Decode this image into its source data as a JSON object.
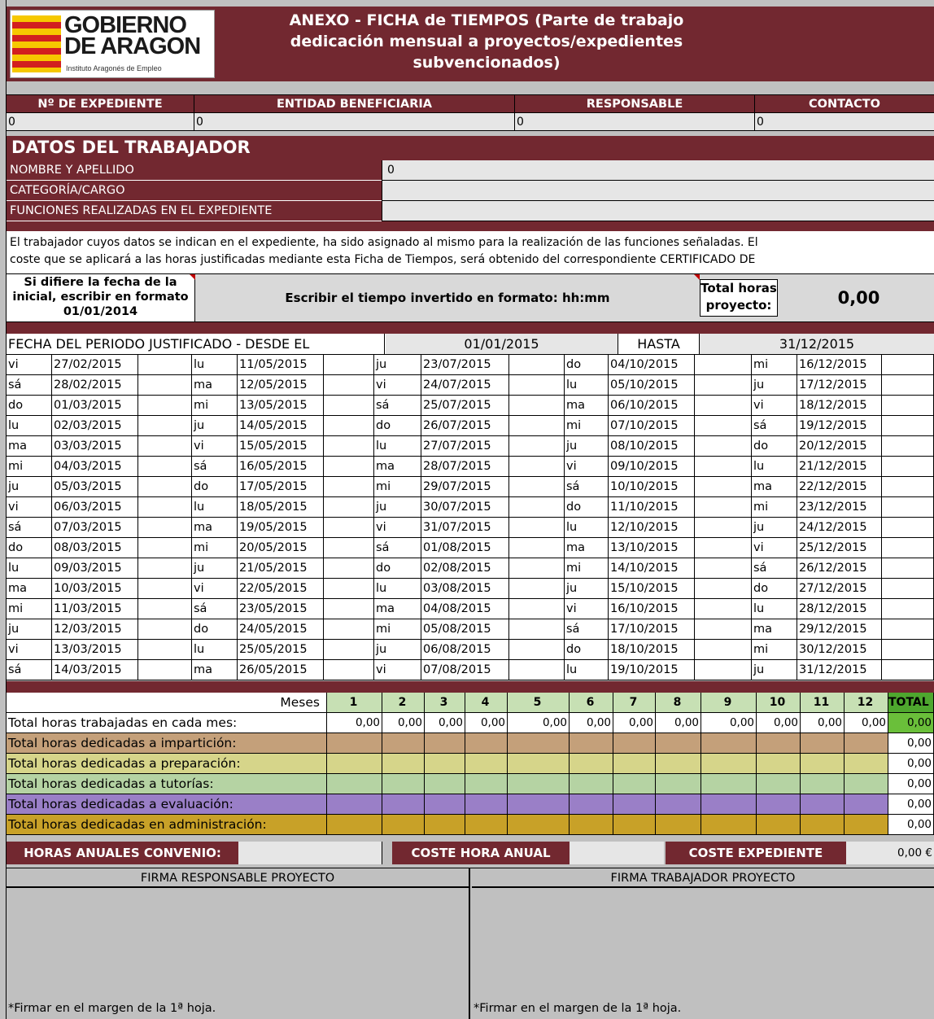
{
  "header": {
    "logo_line1": "GOBIERNO",
    "logo_line2": "DE ARAGON",
    "logo_sub": "Instituto Aragonés de Empleo",
    "title": "ANEXO - FICHA de TIEMPOS (Parte de trabajo dedicación mensual a proyectos/expedientes subvencionados)"
  },
  "summary": {
    "columns": [
      "Nº DE EXPEDIENTE",
      "ENTIDAD BENEFICIARIA",
      "RESPONSABLE",
      "CONTACTO"
    ],
    "values": [
      "0",
      "0",
      "0",
      "0"
    ]
  },
  "worker": {
    "section_title": "DATOS DEL TRABAJADOR",
    "fields": [
      {
        "label": "NOMBRE Y APELLIDO",
        "value": "0"
      },
      {
        "label": "CATEGORÍA/CARGO",
        "value": ""
      },
      {
        "label": "FUNCIONES REALIZADAS EN EL EXPEDIENTE",
        "value": ""
      }
    ]
  },
  "notice": {
    "line1": "El trabajador cuyos datos se indican en el expediente, ha sido asignado al mismo para la realización de las funciones señaladas.  El",
    "line2": "coste que se aplicará a las horas justificadas mediante esta Ficha de Tiempos, será obtenido del correspondiente CERTIFICADO DE"
  },
  "instructions": {
    "date_hint": "Si difiere la fecha de la inicial, escribir en formato 01/01/2014",
    "time_hint": "Escribir el tiempo invertido en formato: hh:mm",
    "total_label": "Total horas proyecto:",
    "total_value": "0,00"
  },
  "period": {
    "label": "FECHA DEL PERIODO JUSTIFICADO - DESDE EL",
    "from": "01/01/2015",
    "to_label": "HASTA",
    "to": "31/12/2015"
  },
  "days": [
    [
      "vi",
      "27/02/2015",
      "lu",
      "11/05/2015",
      "ju",
      "23/07/2015",
      "do",
      "04/10/2015",
      "mi",
      "16/12/2015"
    ],
    [
      "sá",
      "28/02/2015",
      "ma",
      "12/05/2015",
      "vi",
      "24/07/2015",
      "lu",
      "05/10/2015",
      "ju",
      "17/12/2015"
    ],
    [
      "do",
      "01/03/2015",
      "mi",
      "13/05/2015",
      "sá",
      "25/07/2015",
      "ma",
      "06/10/2015",
      "vi",
      "18/12/2015"
    ],
    [
      "lu",
      "02/03/2015",
      "ju",
      "14/05/2015",
      "do",
      "26/07/2015",
      "mi",
      "07/10/2015",
      "sá",
      "19/12/2015"
    ],
    [
      "ma",
      "03/03/2015",
      "vi",
      "15/05/2015",
      "lu",
      "27/07/2015",
      "ju",
      "08/10/2015",
      "do",
      "20/12/2015"
    ],
    [
      "mi",
      "04/03/2015",
      "sá",
      "16/05/2015",
      "ma",
      "28/07/2015",
      "vi",
      "09/10/2015",
      "lu",
      "21/12/2015"
    ],
    [
      "ju",
      "05/03/2015",
      "do",
      "17/05/2015",
      "mi",
      "29/07/2015",
      "sá",
      "10/10/2015",
      "ma",
      "22/12/2015"
    ],
    [
      "vi",
      "06/03/2015",
      "lu",
      "18/05/2015",
      "ju",
      "30/07/2015",
      "do",
      "11/10/2015",
      "mi",
      "23/12/2015"
    ],
    [
      "sá",
      "07/03/2015",
      "ma",
      "19/05/2015",
      "vi",
      "31/07/2015",
      "lu",
      "12/10/2015",
      "ju",
      "24/12/2015"
    ],
    [
      "do",
      "08/03/2015",
      "mi",
      "20/05/2015",
      "sá",
      "01/08/2015",
      "ma",
      "13/10/2015",
      "vi",
      "25/12/2015"
    ],
    [
      "lu",
      "09/03/2015",
      "ju",
      "21/05/2015",
      "do",
      "02/08/2015",
      "mi",
      "14/10/2015",
      "sá",
      "26/12/2015"
    ],
    [
      "ma",
      "10/03/2015",
      "vi",
      "22/05/2015",
      "lu",
      "03/08/2015",
      "ju",
      "15/10/2015",
      "do",
      "27/12/2015"
    ],
    [
      "mi",
      "11/03/2015",
      "sá",
      "23/05/2015",
      "ma",
      "04/08/2015",
      "vi",
      "16/10/2015",
      "lu",
      "28/12/2015"
    ],
    [
      "ju",
      "12/03/2015",
      "do",
      "24/05/2015",
      "mi",
      "05/08/2015",
      "sá",
      "17/10/2015",
      "ma",
      "29/12/2015"
    ],
    [
      "vi",
      "13/03/2015",
      "lu",
      "25/05/2015",
      "ju",
      "06/08/2015",
      "do",
      "18/10/2015",
      "mi",
      "30/12/2015"
    ],
    [
      "sá",
      "14/03/2015",
      "ma",
      "26/05/2015",
      "vi",
      "07/08/2015",
      "lu",
      "19/10/2015",
      "ju",
      "31/12/2015"
    ]
  ],
  "months": {
    "label": "Meses",
    "numbers": [
      "1",
      "2",
      "3",
      "4",
      "5",
      "6",
      "7",
      "8",
      "9",
      "10",
      "11",
      "12"
    ],
    "total_label": "TOTAL",
    "rows": [
      {
        "label": "Total horas trabajadas en cada mes:",
        "values": [
          "0,00",
          "0,00",
          "0,00",
          "0,00",
          "0,00",
          "0,00",
          "0,00",
          "0,00",
          "0,00",
          "0,00",
          "0,00",
          "0,00"
        ],
        "total": "0,00",
        "color": "#ffffff"
      },
      {
        "label": "Total horas dedicadas a impartición:",
        "values": [
          "",
          "",
          "",
          "",
          "",
          "",
          "",
          "",
          "",
          "",
          "",
          ""
        ],
        "total": "0,00",
        "color": "#c4a07a"
      },
      {
        "label": "Total horas dedicadas a preparación:",
        "values": [
          "",
          "",
          "",
          "",
          "",
          "",
          "",
          "",
          "",
          "",
          "",
          ""
        ],
        "total": "0,00",
        "color": "#d6d58a"
      },
      {
        "label": "Total horas dedicadas a tutorías:",
        "values": [
          "",
          "",
          "",
          "",
          "",
          "",
          "",
          "",
          "",
          "",
          "",
          ""
        ],
        "total": "0,00",
        "color": "#b5d3a3"
      },
      {
        "label": "Total horas dedicadas a evaluación:",
        "values": [
          "",
          "",
          "",
          "",
          "",
          "",
          "",
          "",
          "",
          "",
          "",
          ""
        ],
        "total": "0,00",
        "color": "#9a7fc7"
      },
      {
        "label": "Total horas dedicadas en administración:",
        "values": [
          "",
          "",
          "",
          "",
          "",
          "",
          "",
          "",
          "",
          "",
          "",
          ""
        ],
        "total": "0,00",
        "color": "#c8a128"
      }
    ]
  },
  "costs": {
    "hours_label": "HORAS ANUALES CONVENIO:",
    "hours_value": "",
    "hour_cost_label": "COSTE HORA ANUAL",
    "hour_cost_value": "",
    "total_label": "COSTE EXPEDIENTE",
    "total_value": "0,00 €"
  },
  "signatures": {
    "left_title": "FIRMA RESPONSABLE PROYECTO",
    "right_title": "FIRMA TRABAJADOR PROYECTO",
    "left_note": "*Firmar en el margen de la 1ª hoja.",
    "right_note": "*Firmar en el margen de la 1ª hoja."
  },
  "colors": {
    "maroon": "#722830",
    "months_header": "#c7e0b4",
    "total_green": "#6abf3a",
    "total_header": "#4ea72e"
  }
}
